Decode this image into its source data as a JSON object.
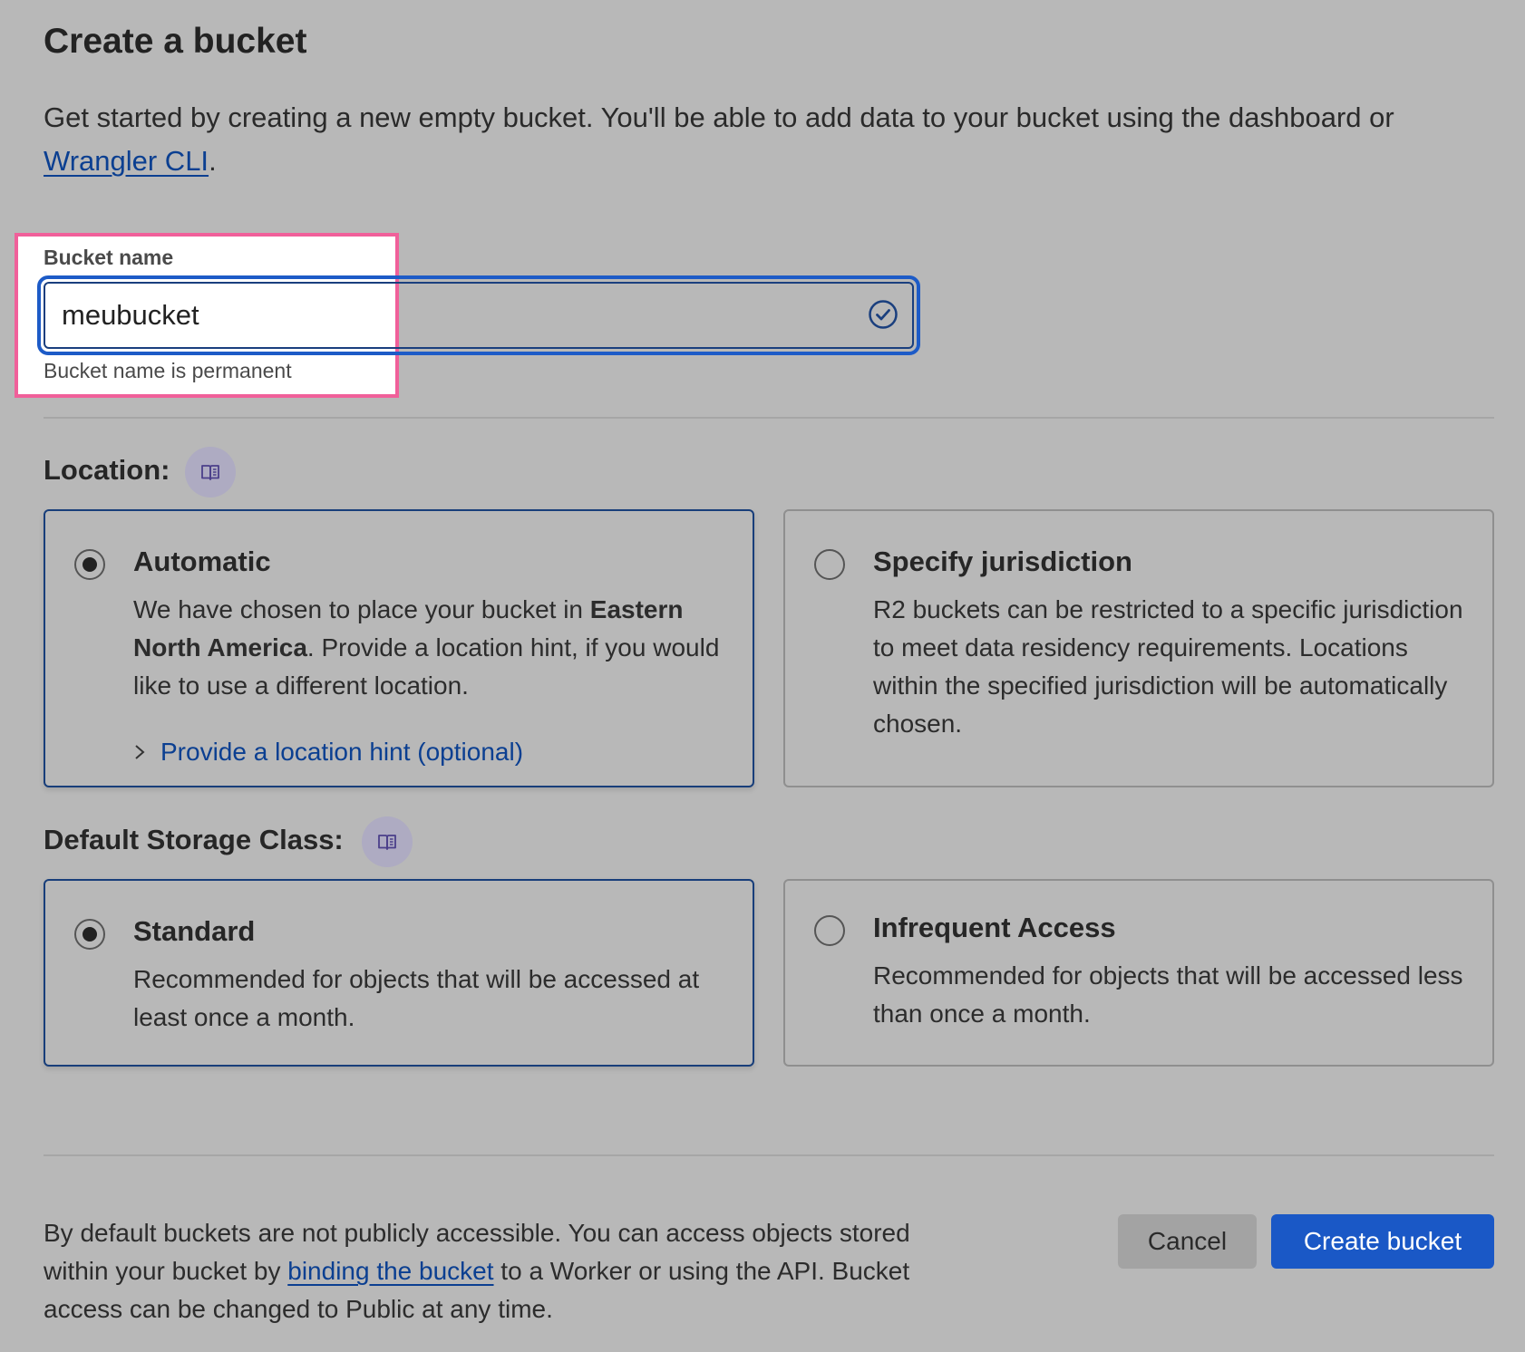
{
  "header": {
    "title": "Create a bucket",
    "intro_text": "Get started by creating a new empty bucket. You'll be able to add data to your bucket using the dashboard or",
    "intro_link": "Wrangler CLI",
    "intro_end": "."
  },
  "bucket_name": {
    "label": "Bucket name",
    "value": "meubucket",
    "help": "Bucket name is permanent",
    "status_icon": "check-circle-icon"
  },
  "location": {
    "label": "Location:",
    "doc_icon": "book-icon",
    "options": [
      {
        "title": "Automatic",
        "selected": true,
        "desc_before": "We have chosen to place your bucket in ",
        "desc_bold": "Eastern North America",
        "desc_after": ". Provide a location hint, if you would like to use a different location.",
        "hint_link": "Provide a location hint (optional)"
      },
      {
        "title": "Specify jurisdiction",
        "selected": false,
        "desc": "R2 buckets can be restricted to a specific jurisdiction to meet data residency requirements. Locations within the specified jurisdiction will be automatically chosen."
      }
    ]
  },
  "storage_class": {
    "label": "Default Storage Class:",
    "doc_icon": "book-icon",
    "options": [
      {
        "title": "Standard",
        "selected": true,
        "desc": "Recommended for objects that will be accessed at least once a month."
      },
      {
        "title": "Infrequent Access",
        "selected": false,
        "desc": "Recommended for objects that will be accessed less than once a month."
      }
    ]
  },
  "footer": {
    "text_before": "By default buckets are not publicly accessible. You can access objects stored within your bucket by ",
    "text_link": "binding the bucket",
    "text_after": " to a Worker or using the API. Bucket access can be changed to Public at any time.",
    "cancel_label": "Cancel",
    "create_label": "Create bucket"
  },
  "colors": {
    "accent": "#1a58c6",
    "link": "#0b3f91",
    "highlight_border": "#f0609a",
    "background": "#b8b8b8"
  }
}
